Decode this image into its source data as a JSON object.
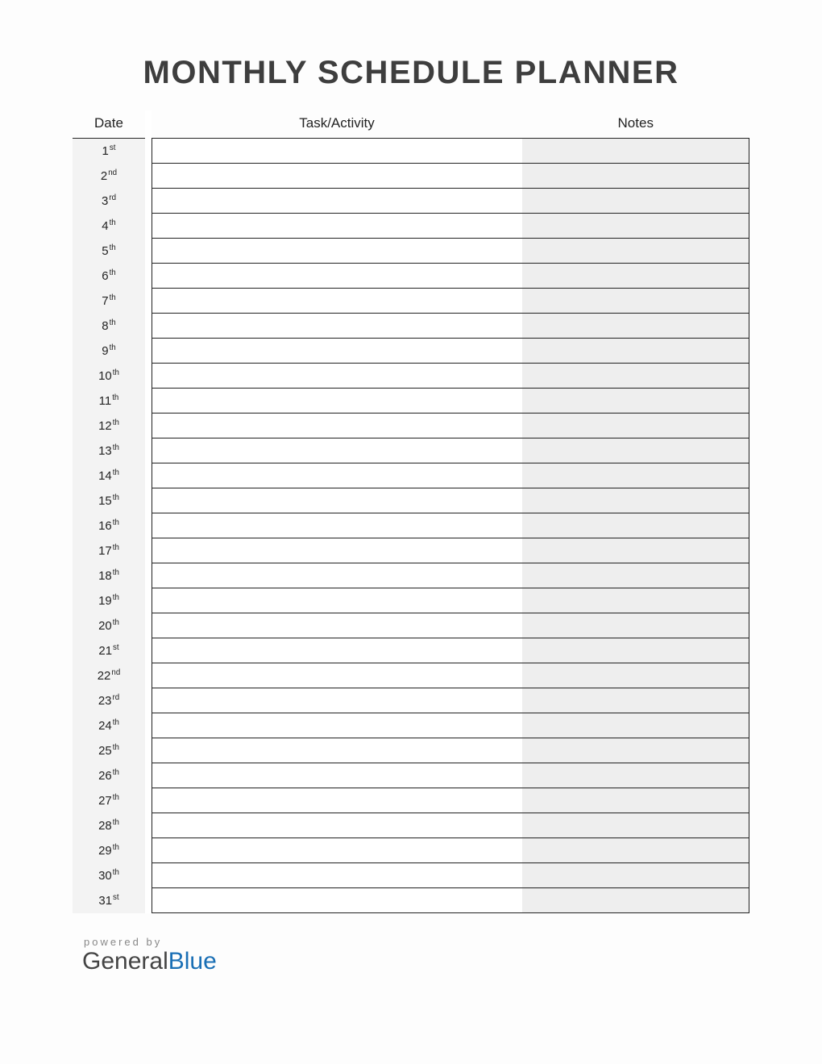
{
  "title": "MONTHLY SCHEDULE PLANNER",
  "columns": {
    "date": "Date",
    "task": "Task/Activity",
    "notes": "Notes"
  },
  "rows": [
    {
      "num": "1",
      "suffix": "st",
      "task": "",
      "notes": ""
    },
    {
      "num": "2",
      "suffix": "nd",
      "task": "",
      "notes": ""
    },
    {
      "num": "3",
      "suffix": "rd",
      "task": "",
      "notes": ""
    },
    {
      "num": "4",
      "suffix": "th",
      "task": "",
      "notes": ""
    },
    {
      "num": "5",
      "suffix": "th",
      "task": "",
      "notes": ""
    },
    {
      "num": "6",
      "suffix": "th",
      "task": "",
      "notes": ""
    },
    {
      "num": "7",
      "suffix": "th",
      "task": "",
      "notes": ""
    },
    {
      "num": "8",
      "suffix": "th",
      "task": "",
      "notes": ""
    },
    {
      "num": "9",
      "suffix": "th",
      "task": "",
      "notes": ""
    },
    {
      "num": "10",
      "suffix": "th",
      "task": "",
      "notes": ""
    },
    {
      "num": "11",
      "suffix": "th",
      "task": "",
      "notes": ""
    },
    {
      "num": "12",
      "suffix": "th",
      "task": "",
      "notes": ""
    },
    {
      "num": "13",
      "suffix": "th",
      "task": "",
      "notes": ""
    },
    {
      "num": "14",
      "suffix": "th",
      "task": "",
      "notes": ""
    },
    {
      "num": "15",
      "suffix": "th",
      "task": "",
      "notes": ""
    },
    {
      "num": "16",
      "suffix": "th",
      "task": "",
      "notes": ""
    },
    {
      "num": "17",
      "suffix": "th",
      "task": "",
      "notes": ""
    },
    {
      "num": "18",
      "suffix": "th",
      "task": "",
      "notes": ""
    },
    {
      "num": "19",
      "suffix": "th",
      "task": "",
      "notes": ""
    },
    {
      "num": "20",
      "suffix": "th",
      "task": "",
      "notes": ""
    },
    {
      "num": "21",
      "suffix": "st",
      "task": "",
      "notes": ""
    },
    {
      "num": "22",
      "suffix": "nd",
      "task": "",
      "notes": ""
    },
    {
      "num": "23",
      "suffix": "rd",
      "task": "",
      "notes": ""
    },
    {
      "num": "24",
      "suffix": "th",
      "task": "",
      "notes": ""
    },
    {
      "num": "25",
      "suffix": "th",
      "task": "",
      "notes": ""
    },
    {
      "num": "26",
      "suffix": "th",
      "task": "",
      "notes": ""
    },
    {
      "num": "27",
      "suffix": "th",
      "task": "",
      "notes": ""
    },
    {
      "num": "28",
      "suffix": "th",
      "task": "",
      "notes": ""
    },
    {
      "num": "29",
      "suffix": "th",
      "task": "",
      "notes": ""
    },
    {
      "num": "30",
      "suffix": "th",
      "task": "",
      "notes": ""
    },
    {
      "num": "31",
      "suffix": "st",
      "task": "",
      "notes": ""
    }
  ],
  "footer": {
    "powered_by": "powered by",
    "brand_first": "General",
    "brand_second": "Blue"
  }
}
